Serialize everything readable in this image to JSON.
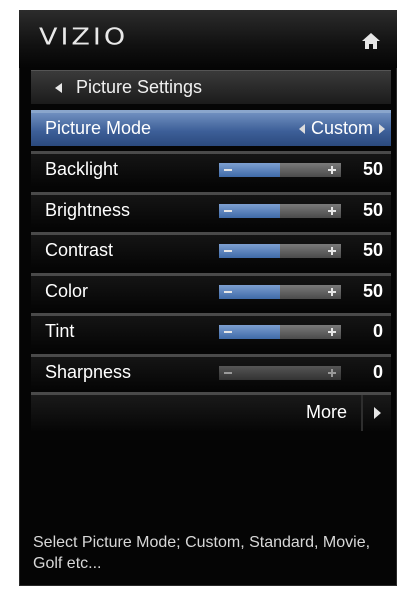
{
  "brand": {
    "logo_text": "VIZIO",
    "home_icon": "home-icon"
  },
  "header": {
    "title": "Picture Settings",
    "back_icon": "back-arrow-icon"
  },
  "picture_mode": {
    "label": "Picture Mode",
    "value": "Custom"
  },
  "settings": [
    {
      "label": "Backlight",
      "value": "50",
      "fraction": 0.5,
      "enabled": true
    },
    {
      "label": "Brightness",
      "value": "50",
      "fraction": 0.5,
      "enabled": true
    },
    {
      "label": "Contrast",
      "value": "50",
      "fraction": 0.5,
      "enabled": true
    },
    {
      "label": "Color",
      "value": "50",
      "fraction": 0.5,
      "enabled": true
    },
    {
      "label": "Tint",
      "value": "0",
      "fraction": 0.5,
      "enabled": true
    },
    {
      "label": "Sharpness",
      "value": "0",
      "fraction": 0.0,
      "enabled": false
    }
  ],
  "more": {
    "label": "More"
  },
  "help_text": "Select Picture Mode; Custom, Standard, Movie, Golf etc...",
  "colors": {
    "selected_row": "#3d5f98",
    "slider_fill": "#5a82bd",
    "background": "#050505"
  }
}
